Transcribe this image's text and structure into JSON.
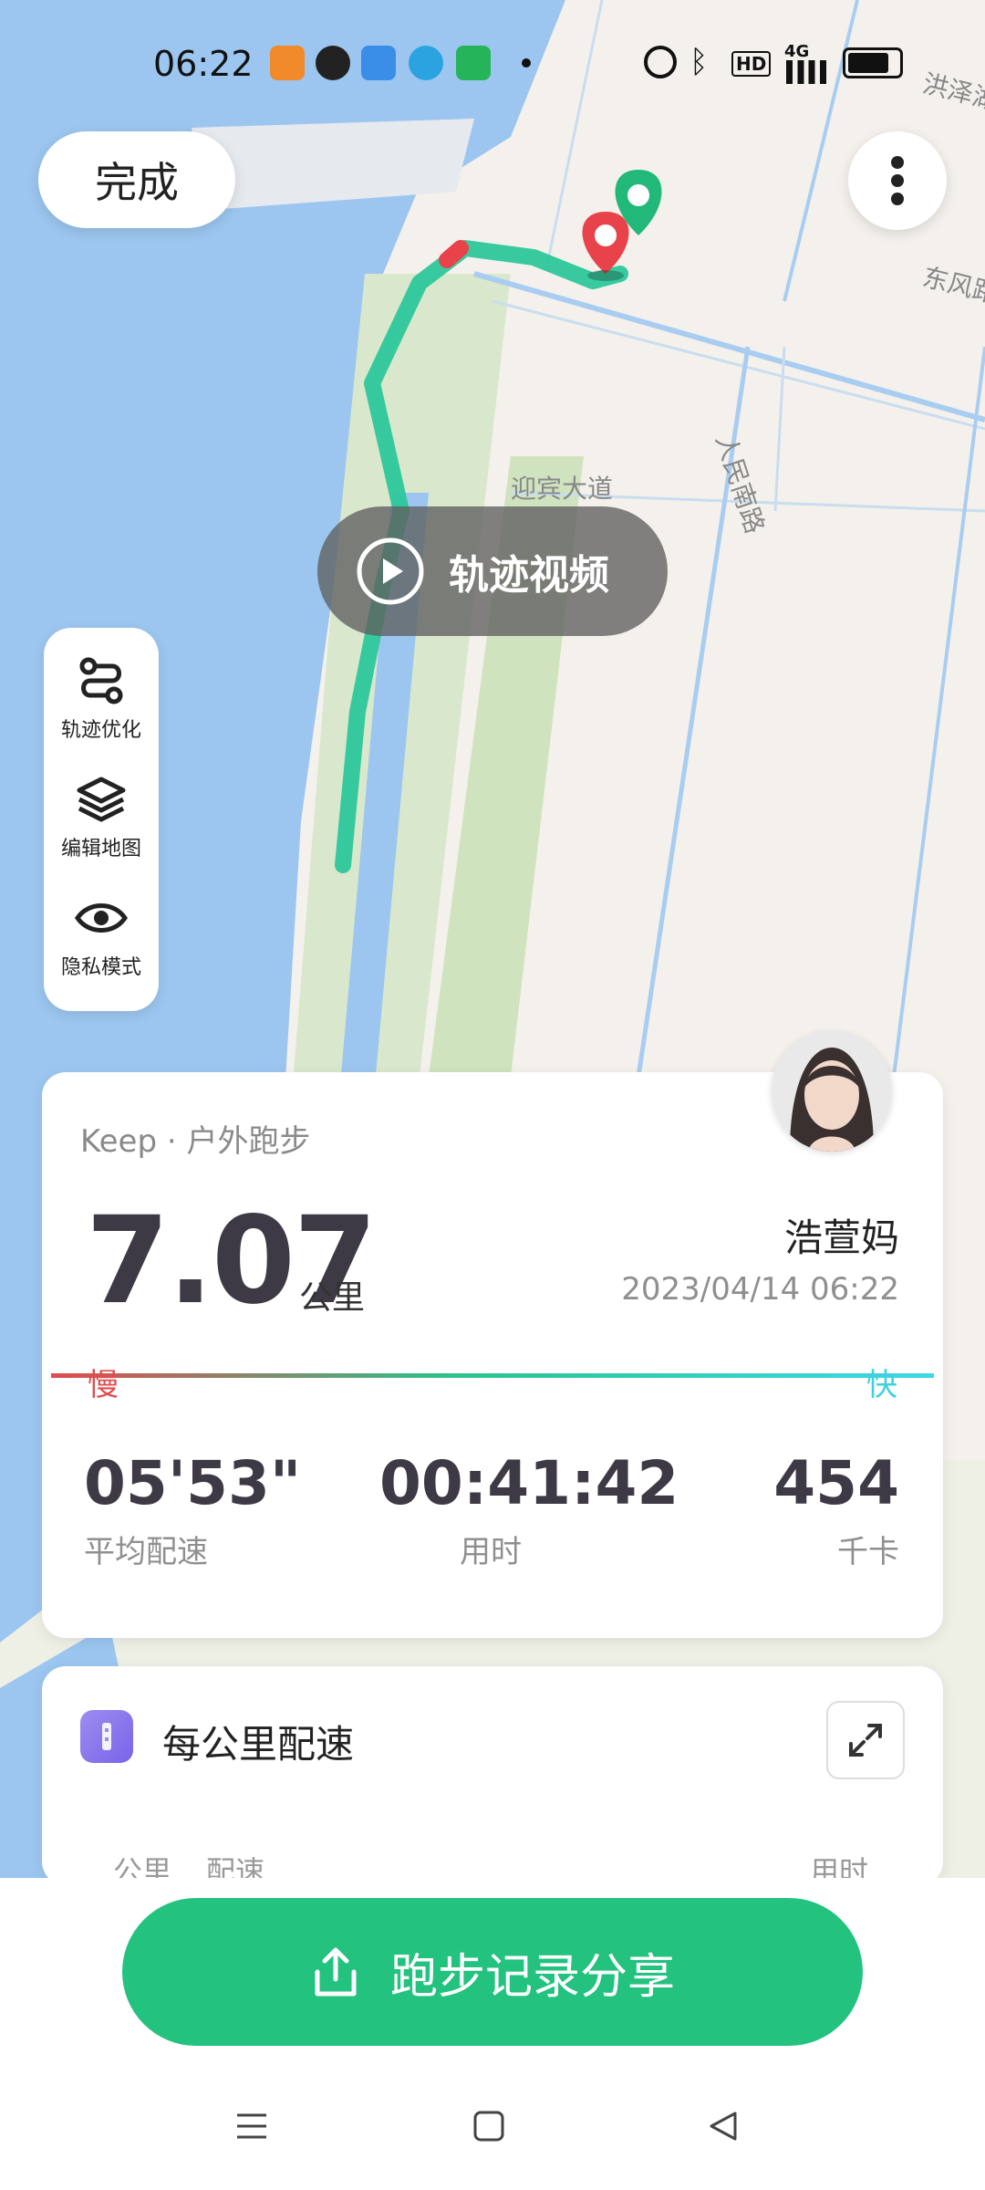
{
  "status_bar": {
    "time": "06:22",
    "network": "4G",
    "hd": "HD",
    "icons": [
      "health-app-icon",
      "wechat-icon",
      "browser-icon",
      "telegram-icon",
      "app-icon",
      "alarm-icon",
      "bluetooth-icon",
      "battery-icon"
    ]
  },
  "map": {
    "road_labels": [
      "迎宾大道",
      "人民南路",
      "东风路",
      "洪泽湖"
    ],
    "start_color": "#22b87a",
    "end_color": "#e8424a"
  },
  "top": {
    "done_label": "完成"
  },
  "video": {
    "label": "轨迹视频"
  },
  "tools": [
    {
      "label": "轨迹优化",
      "icon": "route-icon"
    },
    {
      "label": "编辑地图",
      "icon": "layers-icon"
    },
    {
      "label": "隐私模式",
      "icon": "eye-icon"
    }
  ],
  "summary": {
    "source": "Keep · 户外跑步",
    "distance": "7.07",
    "distance_unit": "公里",
    "user_name": "浩萱妈",
    "datetime": "2023/04/14 06:22",
    "slow_label": "慢",
    "fast_label": "快",
    "stats": [
      {
        "value": "05'53\"",
        "label": "平均配速"
      },
      {
        "value": "00:41:42",
        "label": "用时"
      },
      {
        "value": "454",
        "label": "千卡"
      }
    ]
  },
  "pace_card": {
    "title": "每公里配速",
    "col_km": "公里",
    "col_pace": "配速",
    "col_time": "用时"
  },
  "share": {
    "label": "跑步记录分享"
  },
  "colors": {
    "accent": "#23c27e",
    "route": "#2dc79a"
  }
}
